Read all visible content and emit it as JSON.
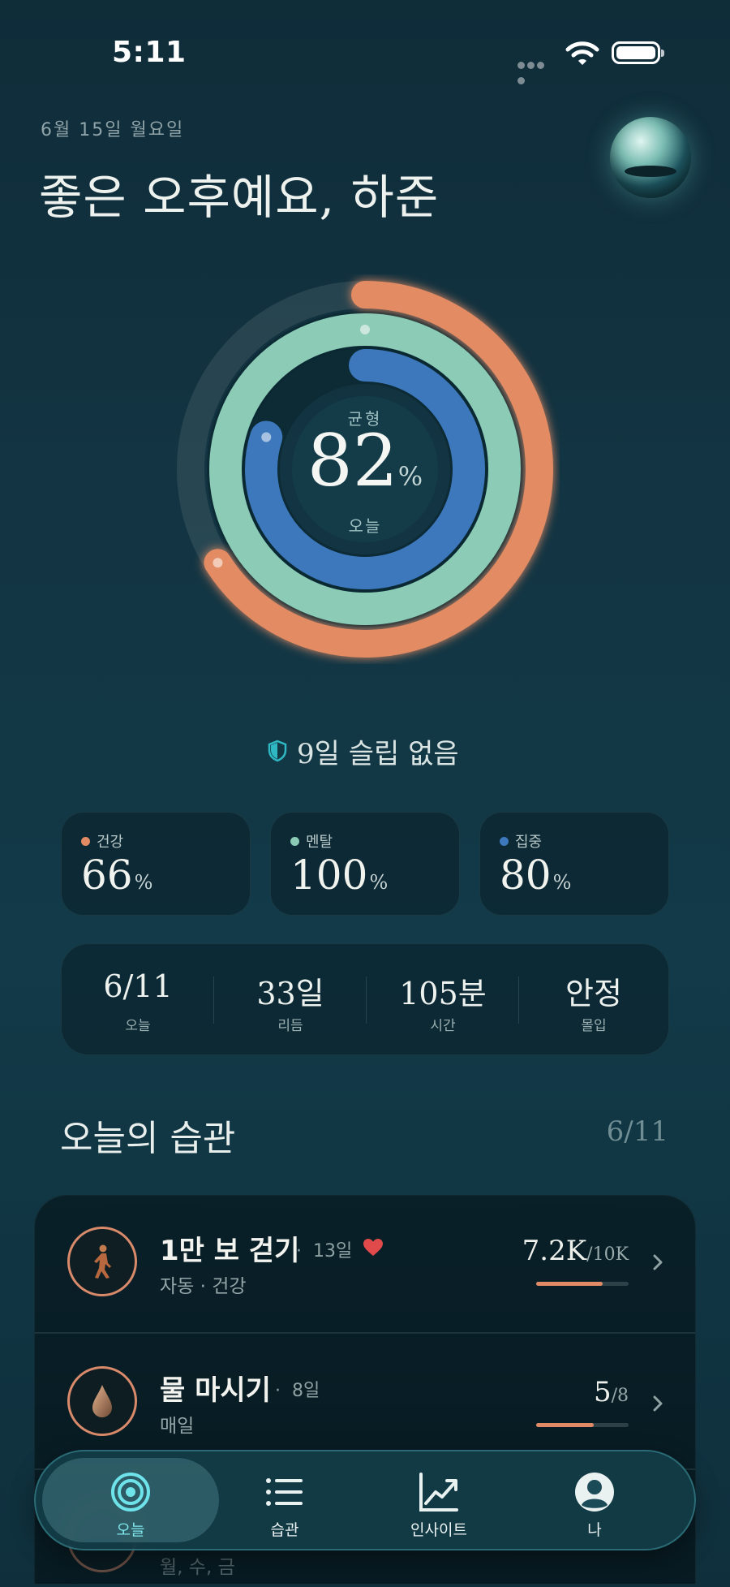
{
  "status_bar": {
    "time": "5:11"
  },
  "header": {
    "date": "6월 15일 월요일",
    "greeting": "좋은 오후예요,  하준"
  },
  "score": {
    "label": "균형",
    "value": "82",
    "unit": "%",
    "sub": "오늘",
    "rings": [
      {
        "name": "건강",
        "progress": 0.66,
        "color": "#e38b64"
      },
      {
        "name": "멘탈",
        "progress": 1.0,
        "color": "#8ccbb6"
      },
      {
        "name": "집중",
        "progress": 0.8,
        "color": "#3d78bd"
      }
    ]
  },
  "streak": {
    "icon": "shield-icon",
    "text": "9일 슬립 없음"
  },
  "stats": [
    {
      "label": "건강",
      "value": "66",
      "unit": "%",
      "color": "#e38b64"
    },
    {
      "label": "멘탈",
      "value": "100",
      "unit": "%",
      "color": "#8ccbb6"
    },
    {
      "label": "집중",
      "value": "80",
      "unit": "%",
      "color": "#3d78bd"
    }
  ],
  "summary": [
    {
      "value": "6/11",
      "label": "오늘"
    },
    {
      "value": "33일",
      "label": "리듬"
    },
    {
      "value": "105분",
      "label": "시간"
    },
    {
      "value": "안정",
      "label": "몰입"
    }
  ],
  "habits_section": {
    "title": "오늘의 습관",
    "count": "6/11"
  },
  "habits": [
    {
      "name": "1만 보 걷기",
      "streak": "13일",
      "sub": "자동 · 건강",
      "value": "7.2K",
      "target": "/10K",
      "progress": 0.72,
      "icon": "walking-icon"
    },
    {
      "name": "물 마시기",
      "streak": "8일",
      "sub": "매일",
      "value": "5",
      "target": "/8",
      "progress": 0.625,
      "icon": "water-drop-icon"
    },
    {
      "name": "",
      "streak": "",
      "sub": "월, 수, 금",
      "value": "",
      "target": "",
      "progress": 0,
      "icon": "habit-icon"
    }
  ],
  "nav": [
    {
      "label": "오늘",
      "icon": "target-icon",
      "active": true
    },
    {
      "label": "습관",
      "icon": "list-icon",
      "active": false
    },
    {
      "label": "인사이트",
      "icon": "chart-icon",
      "active": false
    },
    {
      "label": "나",
      "icon": "profile-icon",
      "active": false
    }
  ],
  "colors": {
    "accent": "#7fe7ec",
    "health": "#e38b64",
    "mental": "#8ccbb6",
    "focus": "#3d78bd"
  }
}
